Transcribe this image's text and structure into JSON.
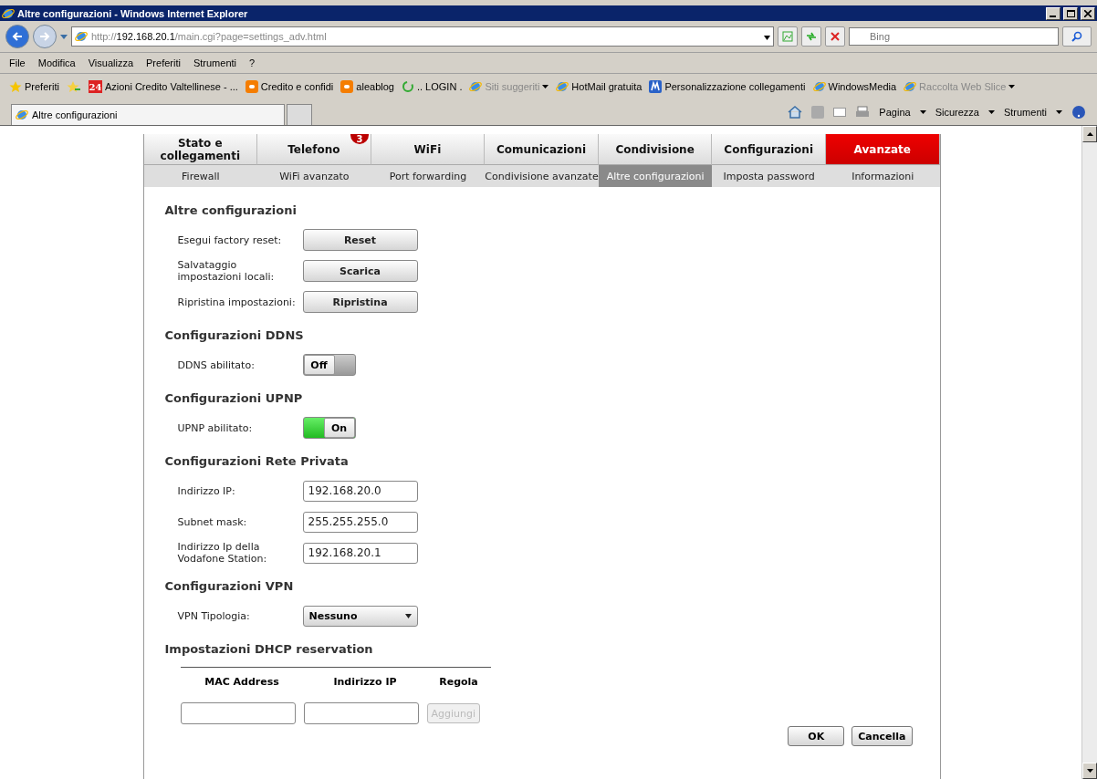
{
  "window": {
    "title": "Altre configurazioni - Windows Internet Explorer"
  },
  "address": {
    "scheme": "http://",
    "host": "192.168.20.1",
    "path": "/main.cgi?page=settings_adv.html"
  },
  "search": {
    "placeholder": "Bing"
  },
  "menu": [
    "File",
    "Modifica",
    "Visualizza",
    "Preferiti",
    "Strumenti",
    "?"
  ],
  "favorites": {
    "label": "Preferiti",
    "links": [
      {
        "text": "Azioni Credito Valtellinese - ...",
        "kind": "square",
        "logo_text": "24",
        "dim": false,
        "dropdown": false
      },
      {
        "text": "Credito e confidi",
        "kind": "blog",
        "dim": false,
        "dropdown": false
      },
      {
        "text": "aleablog",
        "kind": "blog",
        "dim": false,
        "dropdown": false
      },
      {
        "text": ".. LOGIN .",
        "kind": "ring",
        "dim": false,
        "dropdown": false
      },
      {
        "text": "Siti suggeriti",
        "kind": "ie",
        "dim": true,
        "dropdown": true
      },
      {
        "text": "HotMail gratuita",
        "kind": "ie",
        "dim": false,
        "dropdown": false
      },
      {
        "text": "Personalizzazione collegamenti",
        "kind": "m",
        "dim": false,
        "dropdown": false
      },
      {
        "text": "WindowsMedia",
        "kind": "ie",
        "dim": false,
        "dropdown": false
      },
      {
        "text": "Raccolta Web Slice",
        "kind": "ie",
        "dim": true,
        "dropdown": true
      }
    ]
  },
  "browser_tab": {
    "title": "Altre configurazioni"
  },
  "commands": [
    "Pagina",
    "Sicurezza",
    "Strumenti"
  ],
  "nav": [
    {
      "label": "Stato e collegamenti",
      "selected": false
    },
    {
      "label": "Telefono",
      "selected": false,
      "badge": "3"
    },
    {
      "label": "WiFi",
      "selected": false
    },
    {
      "label": "Comunicazioni",
      "selected": false
    },
    {
      "label": "Condivisione",
      "selected": false
    },
    {
      "label": "Configurazioni",
      "selected": false
    },
    {
      "label": "Avanzate",
      "selected": true
    }
  ],
  "subnav": [
    {
      "label": "Firewall",
      "selected": false
    },
    {
      "label": "WiFi avanzato",
      "selected": false
    },
    {
      "label": "Port forwarding",
      "selected": false
    },
    {
      "label": "Condivisione avanzate",
      "selected": false
    },
    {
      "label": "Altre configurazioni",
      "selected": true
    },
    {
      "label": "Imposta password",
      "selected": false
    },
    {
      "label": "Informazioni",
      "selected": false
    }
  ],
  "sections": [
    {
      "title": "Altre configurazioni",
      "rows": [
        {
          "label": "Esegui factory reset:",
          "kind": "button",
          "value": "Reset"
        },
        {
          "label": "Salvataggio impostazioni locali:",
          "kind": "button",
          "value": "Scarica"
        },
        {
          "label": "Ripristina impostazioni:",
          "kind": "button",
          "value": "Ripristina"
        }
      ]
    },
    {
      "title": "Configurazioni DDNS",
      "rows": [
        {
          "label": "DDNS abilitato:",
          "kind": "toggle",
          "value": "Off",
          "on": false
        }
      ]
    },
    {
      "title": "Configurazioni UPNP",
      "rows": [
        {
          "label": "UPNP abilitato:",
          "kind": "toggle",
          "value": "On",
          "on": true
        }
      ]
    },
    {
      "title": "Configurazioni Rete Privata",
      "rows": [
        {
          "label": "Indirizzo IP:",
          "kind": "input",
          "value": "192.168.20.0"
        },
        {
          "label": "Subnet mask:",
          "kind": "input",
          "value": "255.255.255.0"
        },
        {
          "label": "Indirizzo Ip della Vodafone Station:",
          "kind": "input",
          "value": "192.168.20.1"
        }
      ]
    },
    {
      "title": "Configurazioni VPN",
      "rows": [
        {
          "label": "VPN Tipologia:",
          "kind": "select",
          "value": "Nessuno"
        }
      ]
    }
  ],
  "dhcp": {
    "title": "Impostazioni DHCP reservation",
    "columns": [
      "MAC Address",
      "Indirizzo IP",
      "Regola"
    ],
    "add_button": {
      "label": "Aggiungi",
      "disabled": true
    }
  },
  "actions": [
    "OK",
    "Cancella"
  ]
}
